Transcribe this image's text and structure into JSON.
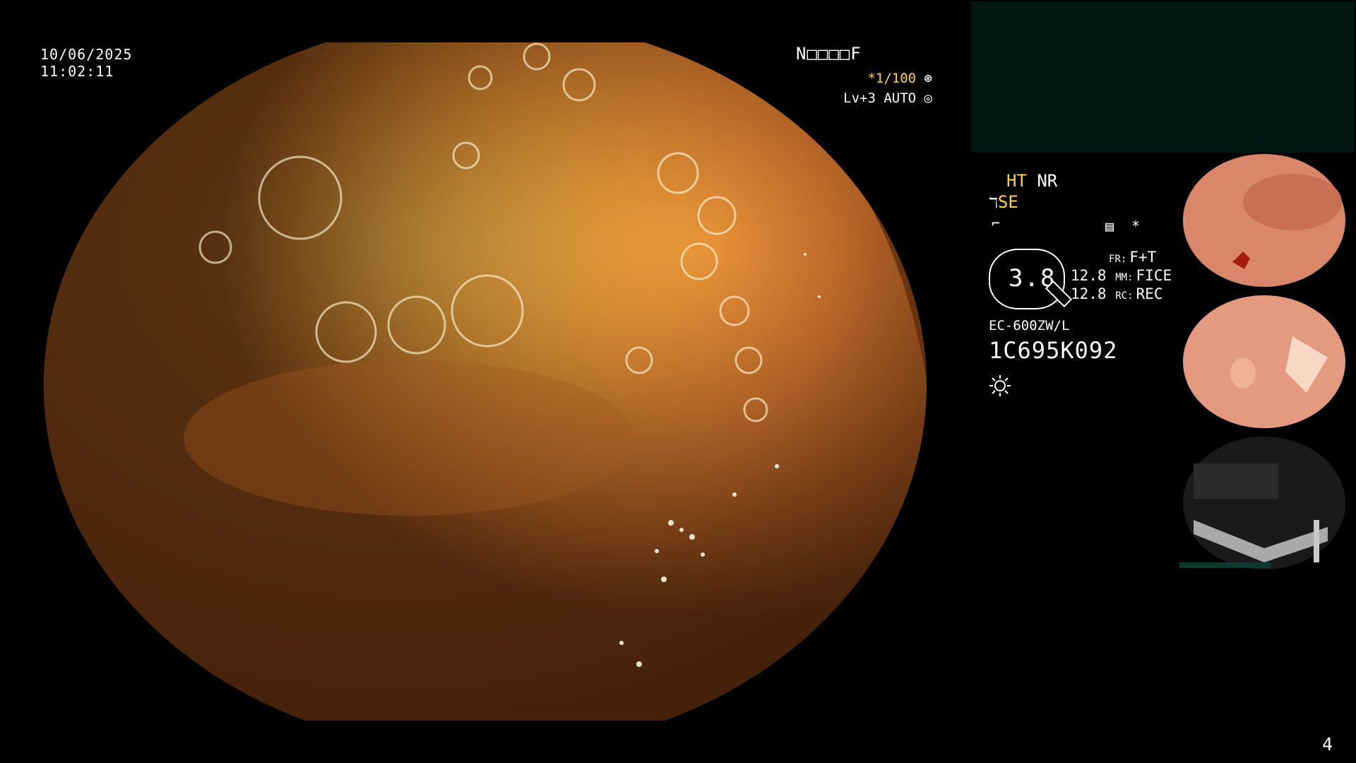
{
  "overlay": {
    "date": "10/06/2025",
    "time": "11:02:11",
    "mode_code": "N□□□□F",
    "shutter": "*1/100",
    "level": "Lv+3 AUTO"
  },
  "status": {
    "ht": "HT",
    "nr": "NR",
    "se": "SE",
    "zoom": "3.8",
    "fr_key": "FR:",
    "fr_val": "F+T",
    "mm_num": "12.8",
    "mm_key": "MM:",
    "mm_val": "FICE",
    "rc_num": "12.8",
    "rc_key": "RC:",
    "rc_val": "REC",
    "scope_model": "EC-600ZW/L",
    "serial": "1C695K092"
  },
  "icons": {
    "shutter_icon": "aperture-icon",
    "level_icon": "target-icon",
    "light_icon": "sun-icon",
    "mode_icon": "doc-icon",
    "star_icon": "asterisk-icon"
  },
  "thumbnails": [
    {
      "label": "thumbnail-1",
      "tone": "#d98a6f"
    },
    {
      "label": "thumbnail-2",
      "tone": "#e29a7e"
    },
    {
      "label": "thumbnail-3",
      "tone": "#1c1c1c"
    }
  ],
  "page": {
    "number": "4"
  },
  "colors": {
    "accent": "#ffd24a",
    "panel": "#031712"
  }
}
